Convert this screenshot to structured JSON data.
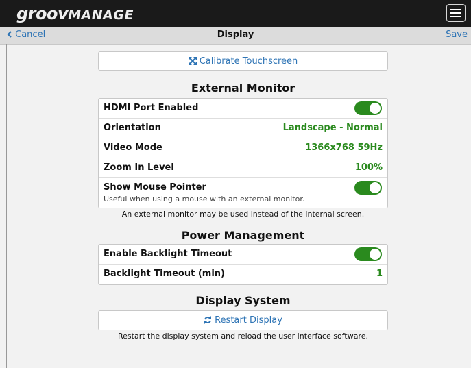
{
  "app": {
    "logo_bold": "groov",
    "logo_rest": "MANAGE"
  },
  "nav": {
    "cancel_label": "Cancel",
    "title": "Display",
    "save_label": "Save"
  },
  "calibrate": {
    "label": "Calibrate Touchscreen",
    "icon": "expand-arrows-icon"
  },
  "external_monitor": {
    "title": "External Monitor",
    "hdmi": {
      "label": "HDMI Port Enabled",
      "enabled": true
    },
    "orientation": {
      "label": "Orientation",
      "value": "Landscape - Normal"
    },
    "video_mode": {
      "label": "Video Mode",
      "value": "1366x768 59Hz"
    },
    "zoom": {
      "label": "Zoom In Level",
      "value": "100%"
    },
    "mouse": {
      "label": "Show Mouse Pointer",
      "sublabel": "Useful when using a mouse with an external monitor.",
      "enabled": true
    },
    "note": "An external monitor may be used instead of the internal screen."
  },
  "power": {
    "title": "Power Management",
    "backlight": {
      "label": "Enable Backlight Timeout",
      "enabled": true
    },
    "timeout": {
      "label": "Backlight Timeout (min)",
      "value": "1"
    }
  },
  "display_system": {
    "title": "Display System",
    "restart_label": "Restart Display",
    "restart_icon": "refresh-icon",
    "note": "Restart the display system and reload the user interface software."
  },
  "colors": {
    "accent_blue": "#2e74b5",
    "value_green": "#2a8a1e",
    "toggle_on": "#2a8a1e",
    "topbar": "#1a1a1a"
  }
}
